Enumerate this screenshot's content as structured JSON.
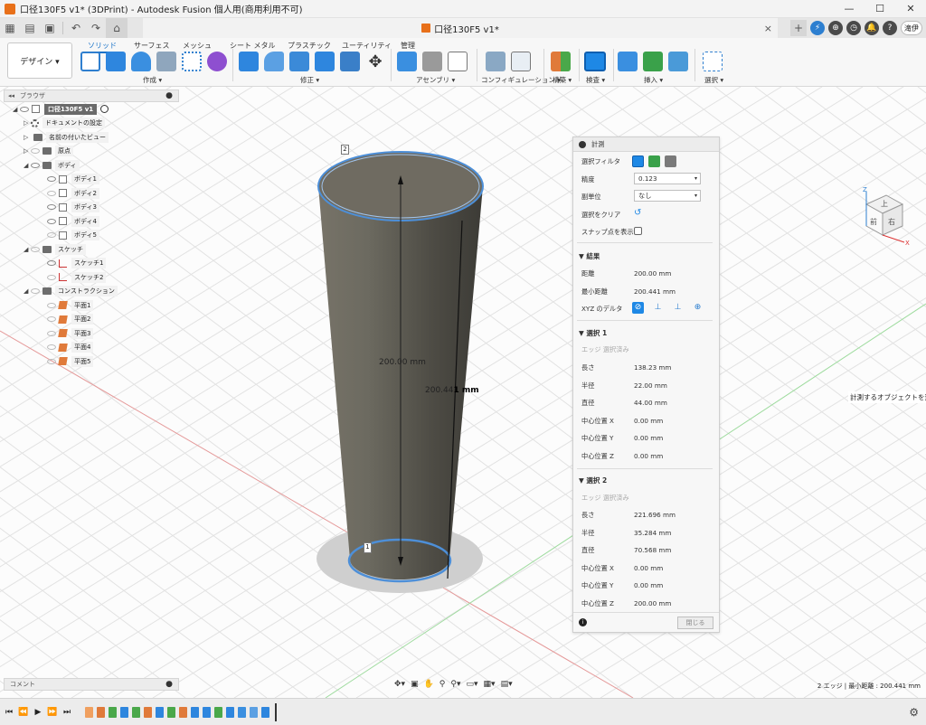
{
  "window": {
    "title": "口径130F5 v1* (3DPrint) - Autodesk Fusion 個人用(商用利用不可)",
    "minimize": "—",
    "maximize": "☐",
    "close": "✕"
  },
  "tab": {
    "title": "口径130F5 v1*",
    "close": "×",
    "avatar": "滝伊"
  },
  "toolbar": {
    "design": "デザイン ▾",
    "workspace_tabs": [
      "ソリッド",
      "サーフェス",
      "メッシュ",
      "シート メタル",
      "プラスチック",
      "ユーティリティ",
      "管理"
    ],
    "groups": [
      "作成 ▾",
      "修正 ▾",
      "アセンブリ ▾",
      "コンフィギュレーション ▾",
      "構築 ▾",
      "検査 ▾",
      "挿入 ▾",
      "選択 ▾"
    ]
  },
  "browser": {
    "title": "ブラウザ",
    "root": "口径130F5 v1",
    "items": [
      "ドキュメントの設定",
      "名前の付いたビュー",
      "原点",
      "ボディ",
      "ボディ1",
      "ボディ2",
      "ボディ3",
      "ボディ4",
      "ボディ5",
      "スケッチ",
      "スケッチ1",
      "スケッチ2",
      "コンストラクション",
      "平面1",
      "平面2",
      "平面3",
      "平面4",
      "平面5"
    ]
  },
  "measure": {
    "title": "計測",
    "filter_label": "選択フィルタ",
    "precision_label": "精度",
    "precision_value": "0.123",
    "subunit_label": "副単位",
    "subunit_value": "なし",
    "clear_label": "選択をクリア",
    "snap_label": "スナップ点を表示",
    "results_title": "結果",
    "distance_label": "距離",
    "distance_value": "200.00 mm",
    "min_distance_label": "最小距離",
    "min_distance_value": "200.441 mm",
    "xyz_label": "XYZ のデルタ",
    "sel1": {
      "title": "選択 1",
      "status": "エッジ 選択済み",
      "rows": [
        [
          "長さ",
          "138.23 mm"
        ],
        [
          "半径",
          "22.00 mm"
        ],
        [
          "直径",
          "44.00 mm"
        ],
        [
          "中心位置 X",
          "0.00 mm"
        ],
        [
          "中心位置 Y",
          "0.00 mm"
        ],
        [
          "中心位置 Z",
          "0.00 mm"
        ]
      ]
    },
    "sel2": {
      "title": "選択 2",
      "status": "エッジ 選択済み",
      "rows": [
        [
          "長さ",
          "221.696 mm"
        ],
        [
          "半径",
          "35.284 mm"
        ],
        [
          "直径",
          "70.568 mm"
        ],
        [
          "中心位置 X",
          "0.00 mm"
        ],
        [
          "中心位置 Y",
          "0.00 mm"
        ],
        [
          "中心位置 Z",
          "200.00 mm"
        ]
      ]
    },
    "close": "閉じる"
  },
  "viewport": {
    "dim1": "200.00 mm",
    "dim2_a": "200.44",
    "dim2_b": "1 mm",
    "marker1": "1",
    "marker2": "2",
    "hint": "計測するオブジェクトを選択"
  },
  "viewcube": {
    "top": "上",
    "front": "前",
    "right": "右",
    "x": "X",
    "z": "Z"
  },
  "comments": {
    "title": "コメント"
  },
  "status": {
    "text": "2 エッジ | 最小距離 : 200.441 mm"
  }
}
